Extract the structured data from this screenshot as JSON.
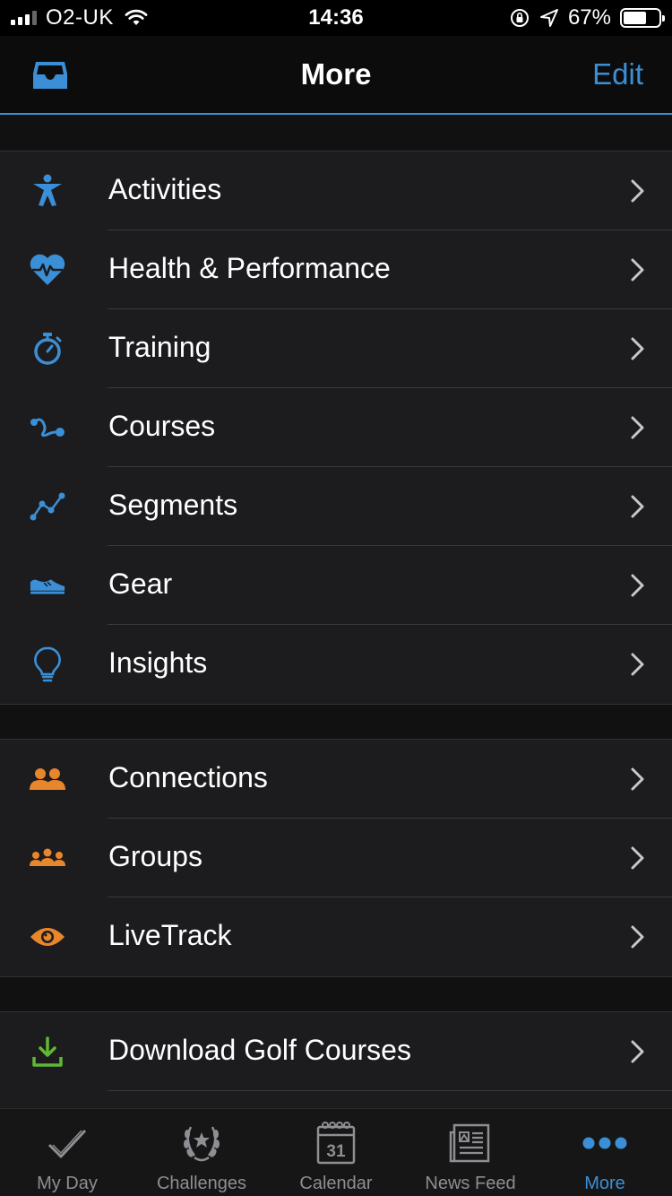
{
  "status_bar": {
    "carrier": "O2-UK",
    "time": "14:36",
    "battery_percent": "67%",
    "battery_level": 0.67
  },
  "nav": {
    "title": "More",
    "edit_label": "Edit",
    "left_icon": "inbox-icon"
  },
  "colors": {
    "accent_blue": "#3b8fd6",
    "accent_orange": "#e8862c",
    "accent_green": "#5fb832",
    "background": "#111111",
    "cell": "#1c1c1e"
  },
  "groups": [
    {
      "items": [
        {
          "label": "Activities",
          "icon": "activities-icon"
        },
        {
          "label": "Health & Performance",
          "icon": "heart-rate-icon"
        },
        {
          "label": "Training",
          "icon": "stopwatch-icon"
        },
        {
          "label": "Courses",
          "icon": "course-route-icon"
        },
        {
          "label": "Segments",
          "icon": "segments-icon"
        },
        {
          "label": "Gear",
          "icon": "shoe-icon"
        },
        {
          "label": "Insights",
          "icon": "lightbulb-icon"
        }
      ]
    },
    {
      "items": [
        {
          "label": "Connections",
          "icon": "connections-icon"
        },
        {
          "label": "Groups",
          "icon": "groups-icon"
        },
        {
          "label": "LiveTrack",
          "icon": "eye-icon"
        }
      ]
    },
    {
      "items": [
        {
          "label": "Download Golf Courses",
          "icon": "download-icon"
        }
      ]
    }
  ],
  "tabs": [
    {
      "label": "My Day",
      "icon": "checkmark-icon"
    },
    {
      "label": "Challenges",
      "icon": "laurel-icon"
    },
    {
      "label": "Calendar",
      "icon": "calendar-icon",
      "day": "31"
    },
    {
      "label": "News Feed",
      "icon": "newspaper-icon"
    },
    {
      "label": "More",
      "icon": "more-dots-icon",
      "active": true
    }
  ]
}
